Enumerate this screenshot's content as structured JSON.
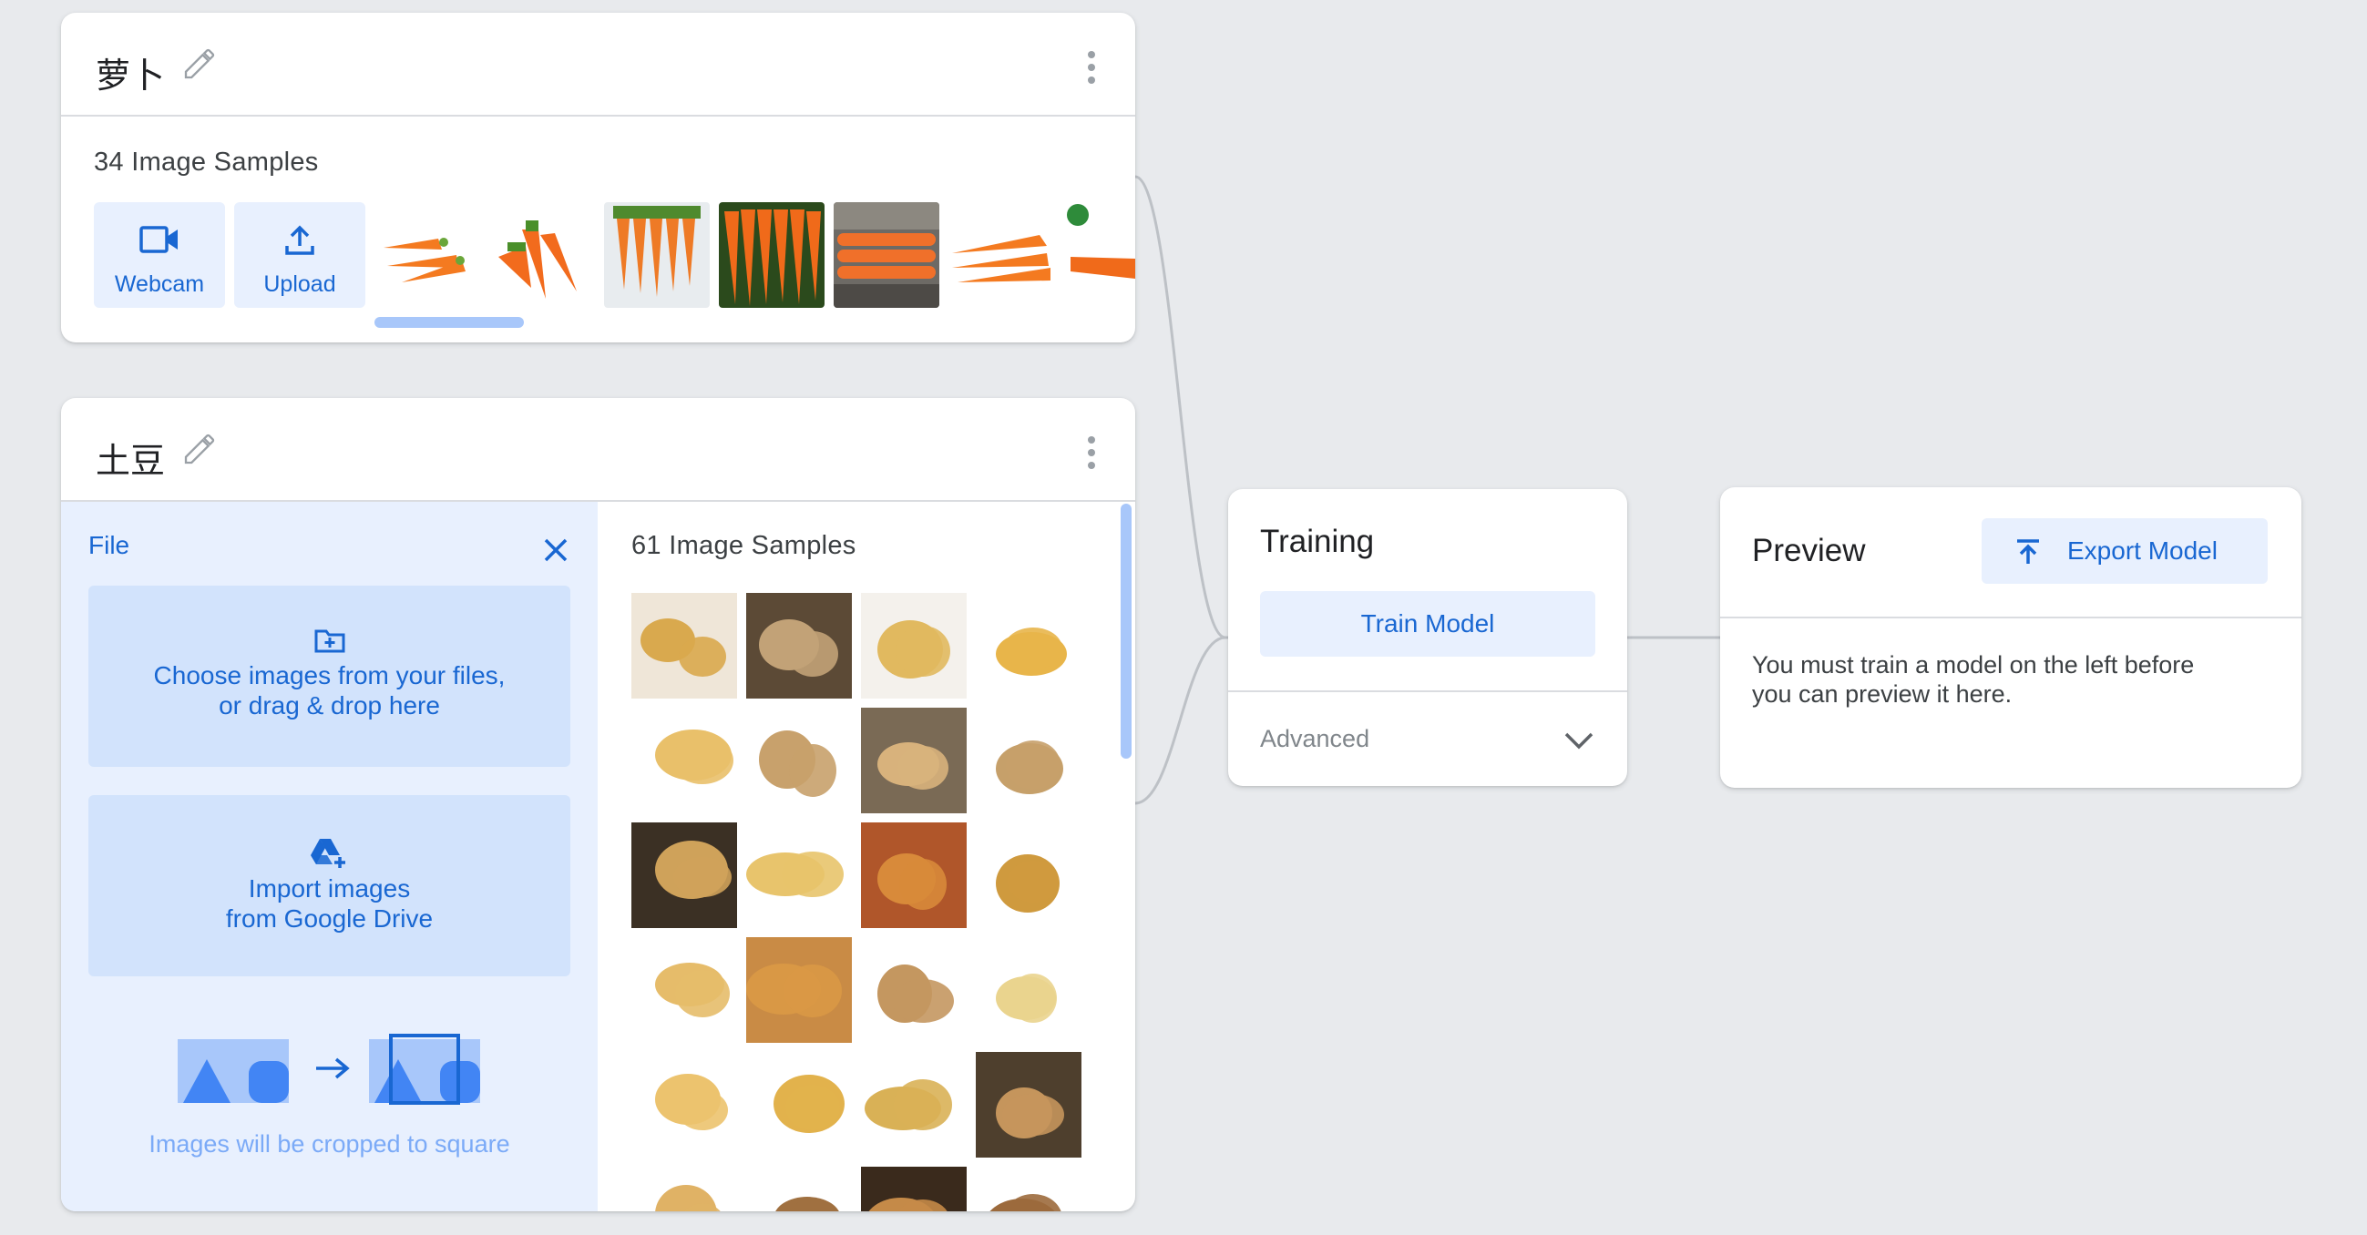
{
  "classes": [
    {
      "name": "萝卜",
      "samples_label": "34 Image Samples",
      "buttons": {
        "webcam": "Webcam",
        "upload": "Upload"
      },
      "sample_images": [
        "carrot-1",
        "carrot-2",
        "carrot-3",
        "carrot-4",
        "carrot-5",
        "carrot-6",
        "carrot-7"
      ]
    },
    {
      "name": "土豆",
      "samples_label": "61 Image Samples",
      "file_panel": {
        "title": "File",
        "choose_line1": "Choose images from your files,",
        "choose_line2": "or drag & drop here",
        "drive_line1": "Import images",
        "drive_line2": "from Google Drive",
        "crop_note": "Images will be cropped to square"
      },
      "sample_images": [
        "potato-1",
        "potato-2",
        "potato-3",
        "potato-4",
        "potato-5",
        "potato-6",
        "potato-7",
        "potato-8",
        "potato-9",
        "potato-10",
        "potato-11",
        "potato-12",
        "potato-13",
        "potato-14",
        "potato-15",
        "potato-16",
        "potato-17",
        "potato-18",
        "potato-19",
        "potato-20",
        "potato-21",
        "potato-22",
        "potato-23",
        "potato-24"
      ]
    }
  ],
  "training": {
    "title": "Training",
    "train_button": "Train Model",
    "advanced_label": "Advanced"
  },
  "preview": {
    "title": "Preview",
    "export_button": "Export Model",
    "message_line1": "You must train a model on the left before",
    "message_line2": "you can preview it here."
  },
  "icons": {
    "edit": "pencil-icon",
    "menu": "more-vert-icon",
    "webcam": "videocam-icon",
    "upload": "upload-icon",
    "close": "close-icon",
    "folder": "add-folder-icon",
    "drive": "google-drive-icon",
    "export": "export-icon",
    "expand": "chevron-down-icon"
  },
  "colors": {
    "accent": "#1967d2",
    "button_bg": "#e8f0fe",
    "panel_bg": "#e8f0fe",
    "box_bg": "#d2e3fc",
    "page_bg": "#e8eaed"
  }
}
